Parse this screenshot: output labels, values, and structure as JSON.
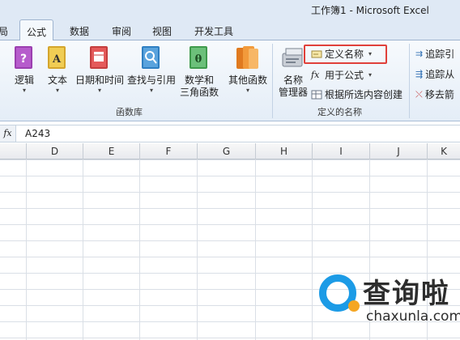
{
  "window": {
    "title": "工作簿1 - Microsoft Excel"
  },
  "tabs": [
    {
      "label": "局"
    },
    {
      "label": "公式"
    },
    {
      "label": "数据"
    },
    {
      "label": "审阅"
    },
    {
      "label": "视图"
    },
    {
      "label": "开发工具"
    }
  ],
  "ribbon": {
    "function_library": {
      "label": "函数库",
      "buttons": [
        {
          "label": "逻辑",
          "icon": "logic-book-icon"
        },
        {
          "label": "文本",
          "icon": "text-book-icon"
        },
        {
          "label": "日期和时间",
          "icon": "date-time-book-icon"
        },
        {
          "label": "查找与引用",
          "icon": "lookup-reference-book-icon"
        },
        {
          "label_1": "数学和",
          "label_2": "三角函数",
          "icon": "math-trig-book-icon"
        },
        {
          "label": "其他函数",
          "icon": "more-functions-book-icon"
        }
      ]
    },
    "defined_names": {
      "label": "定义的名称",
      "name_manager_1": "名称",
      "name_manager_2": "管理器",
      "define_name": "定义名称",
      "use_in_formula": "用于公式",
      "create_from_selection": "根据所选内容创建"
    },
    "formula_auditing": {
      "trace_precedents": "追踪引",
      "trace_dependents": "追踪从",
      "remove_arrows": "移去箭"
    }
  },
  "formula_bar": {
    "fx": "fx",
    "value": "A243"
  },
  "columns": [
    "D",
    "E",
    "F",
    "G",
    "H",
    "I",
    "J",
    "K"
  ],
  "watermark": {
    "text": "查询啦",
    "url": "chaxunla.com"
  },
  "colors": {
    "highlight": "#e0403a",
    "watermark_blue": "#1c9be6",
    "watermark_orange": "#f5a623"
  }
}
